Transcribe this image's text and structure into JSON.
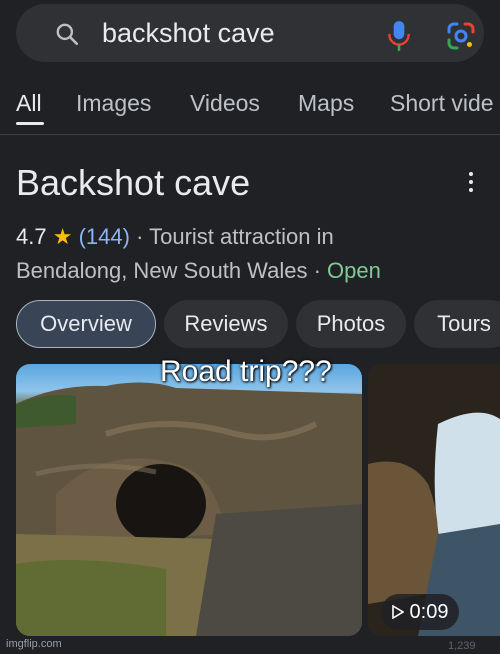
{
  "search": {
    "query": "backshot cave"
  },
  "tabs": [
    {
      "label": "All",
      "active": true
    },
    {
      "label": "Images"
    },
    {
      "label": "Videos"
    },
    {
      "label": "Maps"
    },
    {
      "label": "Short vide"
    }
  ],
  "place": {
    "title": "Backshot cave",
    "rating": "4.7",
    "reviews": "(144)",
    "category": "· Tourist attraction in",
    "location": "Bendalong, New South Wales",
    "status_sep": "·",
    "status": "Open"
  },
  "chips": [
    "Overview",
    "Reviews",
    "Photos",
    "Tours"
  ],
  "media": {
    "caption": "Road trip???",
    "duration": "0:09"
  },
  "footer": {
    "watermark": "imgflip.com",
    "counter": "1,239"
  },
  "icons": {
    "search": "search-icon",
    "mic": "microphone-icon",
    "lens": "google-lens-icon",
    "more": "more-vert-icon",
    "play": "play-icon"
  },
  "colors": {
    "background": "#202124",
    "link": "#8ab4f8",
    "open": "#81c995",
    "star": "#fbbc04"
  }
}
